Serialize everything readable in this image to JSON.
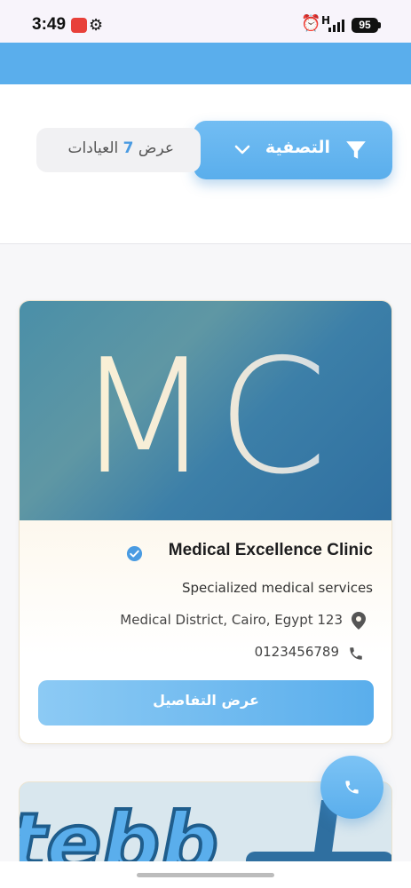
{
  "status_bar": {
    "time": "3:49",
    "signal_label": "H",
    "battery": "95",
    "icons": [
      "app-notification-icon",
      "gear-icon",
      "alarm-icon",
      "signal-icon",
      "battery-icon"
    ]
  },
  "filter": {
    "button_label": "التصفية",
    "count_prefix": "عرض",
    "count_number": "7",
    "count_suffix": "العيادات"
  },
  "clinics": [
    {
      "initials": "MC",
      "name": "Medical Excellence Clinic",
      "verified": true,
      "description": "Specialized medical services",
      "address": "Medical District, Cairo, Egypt 123",
      "phone": "0123456789",
      "details_label": "عرض التفاصيل"
    },
    {
      "logo_partial_text": "tebb"
    }
  ],
  "colors": {
    "accent": "#5aaeec",
    "accent_light": "#8ccaf4",
    "count_number": "#4a9be2",
    "verified": "#4a9be2",
    "card_border": "#ece3cf"
  }
}
